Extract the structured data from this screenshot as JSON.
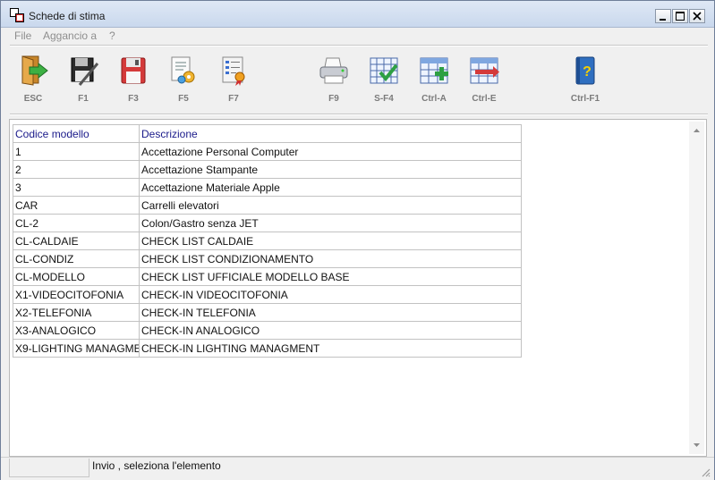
{
  "window": {
    "title": "Schede di stima"
  },
  "menu": [
    "File",
    "Aggancio a",
    "?"
  ],
  "toolbar": [
    {
      "label": "ESC",
      "icon": "exit-door-icon"
    },
    {
      "label": "F1",
      "icon": "save-disk-icon"
    },
    {
      "label": "F3",
      "icon": "floppy-disk-icon"
    },
    {
      "label": "F5",
      "icon": "document-settings-icon"
    },
    {
      "label": "F7",
      "icon": "list-ribbon-icon"
    },
    {
      "label": "F9",
      "icon": "printer-icon"
    },
    {
      "label": "S-F4",
      "icon": "grid-check-icon"
    },
    {
      "label": "Ctrl-A",
      "icon": "grid-add-icon"
    },
    {
      "label": "Ctrl-E",
      "icon": "grid-remove-icon"
    },
    {
      "label": "Ctrl-F1",
      "icon": "help-book-icon"
    }
  ],
  "table": {
    "headers": [
      "Codice modello",
      "Descrizione"
    ],
    "rows": [
      [
        "1",
        "Accettazione Personal Computer"
      ],
      [
        "2",
        "Accettazione Stampante"
      ],
      [
        "3",
        "Accettazione Materiale Apple"
      ],
      [
        "CAR",
        "Carrelli elevatori"
      ],
      [
        "CL-2",
        "Colon/Gastro senza JET"
      ],
      [
        "CL-CALDAIE",
        "CHECK LIST CALDAIE"
      ],
      [
        "CL-CONDIZ",
        "CHECK LIST CONDIZIONAMENTO"
      ],
      [
        "CL-MODELLO",
        "CHECK LIST UFFICIALE MODELLO BASE"
      ],
      [
        "X1-VIDEOCITOFONIA",
        "CHECK-IN  VIDEOCITOFONIA"
      ],
      [
        "X2-TELEFONIA",
        "CHECK-IN  TELEFONIA"
      ],
      [
        "X3-ANALOGICO",
        "CHECK-IN  ANALOGICO"
      ],
      [
        "X9-LIGHTING MANAGME",
        "CHECK-IN  LIGHTING MANAGMENT"
      ]
    ]
  },
  "status": {
    "text": "Invio , seleziona l'elemento"
  }
}
